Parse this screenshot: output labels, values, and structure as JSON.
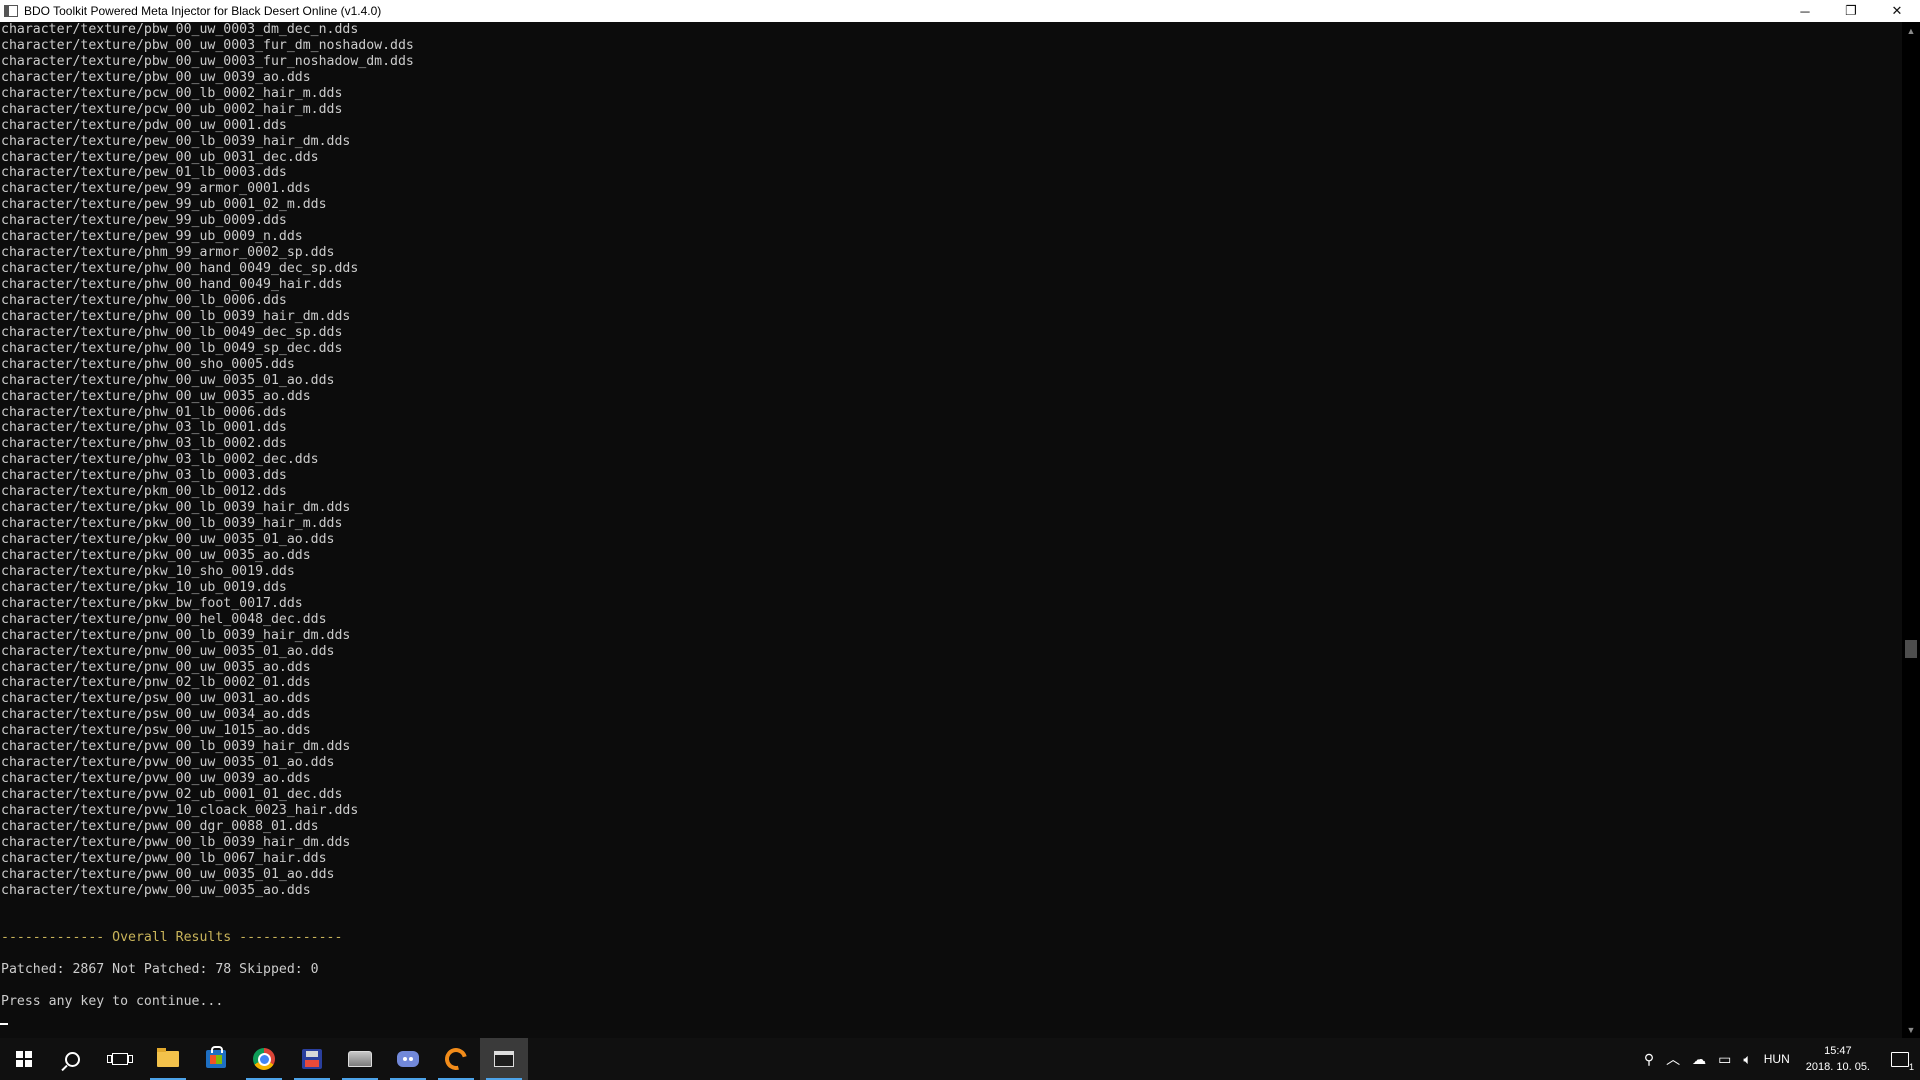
{
  "window": {
    "title": "BDO Toolkit Powered Meta Injector for Black Desert Online (v1.4.0)",
    "minimize_glyph": "─",
    "restore_glyph": "❐",
    "close_glyph": "✕"
  },
  "console": {
    "file_lines": [
      "character/texture/pbw_00_uw_0003_dm_dec_n.dds",
      "character/texture/pbw_00_uw_0003_fur_dm_noshadow.dds",
      "character/texture/pbw_00_uw_0003_fur_noshadow_dm.dds",
      "character/texture/pbw_00_uw_0039_ao.dds",
      "character/texture/pcw_00_lb_0002_hair_m.dds",
      "character/texture/pcw_00_ub_0002_hair_m.dds",
      "character/texture/pdw_00_uw_0001.dds",
      "character/texture/pew_00_lb_0039_hair_dm.dds",
      "character/texture/pew_00_ub_0031_dec.dds",
      "character/texture/pew_01_lb_0003.dds",
      "character/texture/pew_99_armor_0001.dds",
      "character/texture/pew_99_ub_0001_02_m.dds",
      "character/texture/pew_99_ub_0009.dds",
      "character/texture/pew_99_ub_0009_n.dds",
      "character/texture/phm_99_armor_0002_sp.dds",
      "character/texture/phw_00_hand_0049_dec_sp.dds",
      "character/texture/phw_00_hand_0049_hair.dds",
      "character/texture/phw_00_lb_0006.dds",
      "character/texture/phw_00_lb_0039_hair_dm.dds",
      "character/texture/phw_00_lb_0049_dec_sp.dds",
      "character/texture/phw_00_lb_0049_sp_dec.dds",
      "character/texture/phw_00_sho_0005.dds",
      "character/texture/phw_00_uw_0035_01_ao.dds",
      "character/texture/phw_00_uw_0035_ao.dds",
      "character/texture/phw_01_lb_0006.dds",
      "character/texture/phw_03_lb_0001.dds",
      "character/texture/phw_03_lb_0002.dds",
      "character/texture/phw_03_lb_0002_dec.dds",
      "character/texture/phw_03_lb_0003.dds",
      "character/texture/pkm_00_lb_0012.dds",
      "character/texture/pkw_00_lb_0039_hair_dm.dds",
      "character/texture/pkw_00_lb_0039_hair_m.dds",
      "character/texture/pkw_00_uw_0035_01_ao.dds",
      "character/texture/pkw_00_uw_0035_ao.dds",
      "character/texture/pkw_10_sho_0019.dds",
      "character/texture/pkw_10_ub_0019.dds",
      "character/texture/pkw_bw_foot_0017.dds",
      "character/texture/pnw_00_hel_0048_dec.dds",
      "character/texture/pnw_00_lb_0039_hair_dm.dds",
      "character/texture/pnw_00_uw_0035_01_ao.dds",
      "character/texture/pnw_00_uw_0035_ao.dds",
      "character/texture/pnw_02_lb_0002_01.dds",
      "character/texture/psw_00_uw_0031_ao.dds",
      "character/texture/psw_00_uw_0034_ao.dds",
      "character/texture/psw_00_uw_1015_ao.dds",
      "character/texture/pvw_00_lb_0039_hair_dm.dds",
      "character/texture/pvw_00_uw_0035_01_ao.dds",
      "character/texture/pvw_00_uw_0039_ao.dds",
      "character/texture/pvw_02_ub_0001_01_dec.dds",
      "character/texture/pvw_10_cloack_0023_hair.dds",
      "character/texture/pww_00_dgr_0088_01.dds",
      "character/texture/pww_00_lb_0039_hair_dm.dds",
      "character/texture/pww_00_lb_0067_hair.dds",
      "character/texture/pww_00_uw_0035_01_ao.dds",
      "character/texture/pww_00_uw_0035_ao.dds"
    ],
    "results_header": "------------- Overall Results -------------",
    "results_line": "Patched: 2867 Not Patched: 78 Skipped: 0",
    "prompt_line": "Press any key to continue...",
    "text_color": "#cccccc",
    "header_color": "#c9b45a"
  },
  "taskbar": {
    "tray_language": "HUN",
    "clock_time": "15:47",
    "clock_date": "2018. 10. 05.",
    "notification_count": "1",
    "tray_up_glyph": "︿",
    "accent_color": "#4da3e8"
  }
}
